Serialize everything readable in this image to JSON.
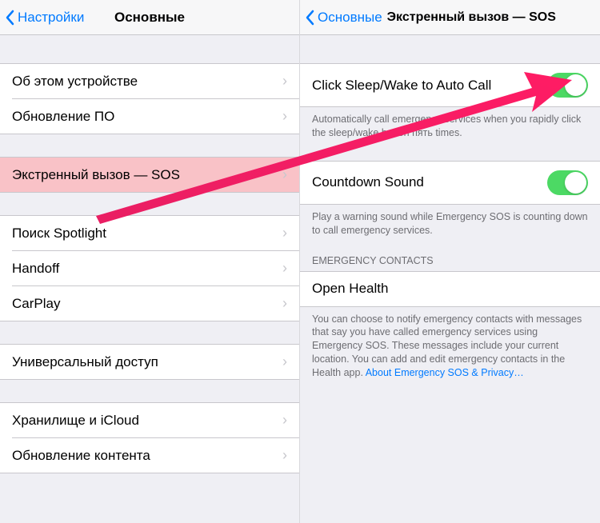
{
  "left": {
    "back_label": "Настройки",
    "title": "Основные",
    "groups": [
      {
        "items": [
          {
            "label": "Об этом устройстве"
          },
          {
            "label": "Обновление ПО"
          }
        ]
      },
      {
        "items": [
          {
            "label": "Экстренный вызов — SOS",
            "highlight": true
          }
        ]
      },
      {
        "items": [
          {
            "label": "Поиск Spotlight"
          },
          {
            "label": "Handoff"
          },
          {
            "label": "CarPlay"
          }
        ]
      },
      {
        "items": [
          {
            "label": "Универсальный доступ"
          }
        ]
      },
      {
        "items": [
          {
            "label": "Хранилище и iCloud"
          },
          {
            "label": "Обновление контента"
          }
        ]
      }
    ]
  },
  "right": {
    "back_label": "Основные",
    "title": "Экстренный вызов — SOS",
    "autocall_label": "Click Sleep/Wake to Auto Call",
    "autocall_footer": "Automatically call emergency services when you rapidly click the sleep/wake button пять times.",
    "countdown_label": "Countdown Sound",
    "countdown_footer": "Play a warning sound while Emergency SOS is counting down to call emergency services.",
    "contacts_header": "EMERGENCY CONTACTS",
    "open_health": "Open Health",
    "contacts_footer_1": "You can choose to notify emergency contacts with messages that say you have called emergency services using Emergency SOS. These messages include your current location. You can add and edit emergency contacts in the Health app. ",
    "contacts_footer_link": "About Emergency SOS & Privacy…"
  }
}
